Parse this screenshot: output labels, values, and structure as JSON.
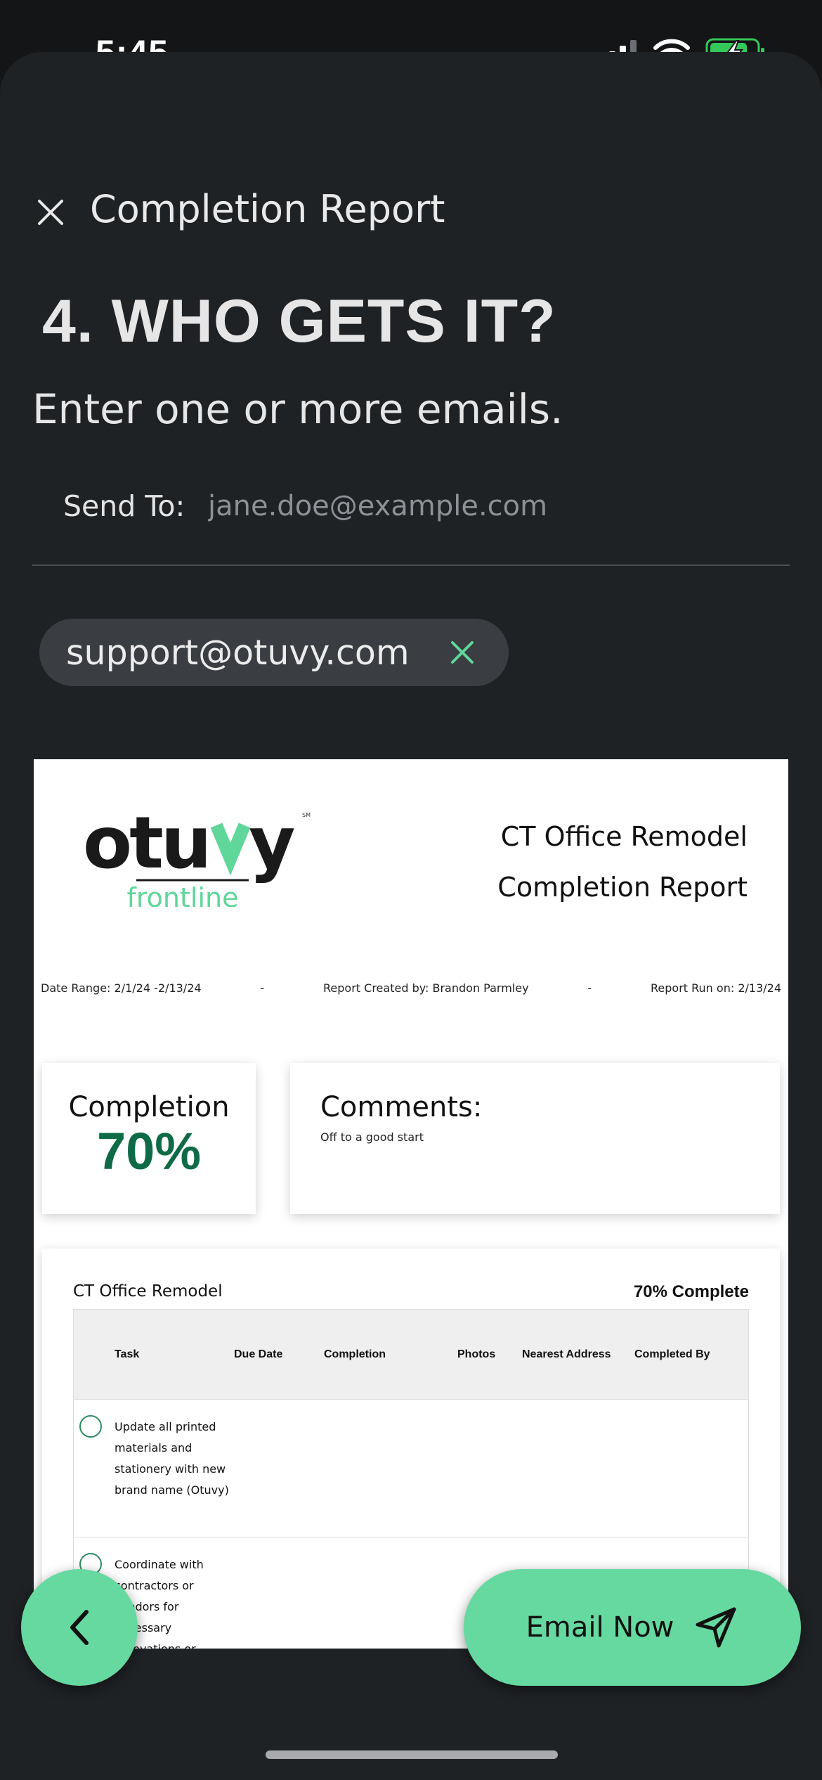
{
  "status_bar": {
    "time": "5:45",
    "icons": [
      "cellular-signal-icon",
      "wifi-icon",
      "battery-charging-icon"
    ]
  },
  "header": {
    "title": "Completion Report",
    "close_icon": "close-icon"
  },
  "step": {
    "heading": "4. WHO GETS IT?",
    "instruction": "Enter one or more emails."
  },
  "send_to": {
    "label": "Send To:",
    "placeholder": "jane.doe@example.com",
    "value": ""
  },
  "recipients": [
    {
      "email": "support@otuvy.com"
    }
  ],
  "report": {
    "logo_text": "otuvy",
    "logo_subtext": "frontline",
    "title_line1": "CT Office Remodel",
    "title_line2": "Completion Report",
    "meta": {
      "date_range": "Date Range: 2/1/24 -2/13/24",
      "sep1": "-",
      "created_by": "Report Created by: Brandon Parmley",
      "sep2": "-",
      "run_on": "Report Run on: 2/13/24"
    },
    "completion": {
      "label": "Completion",
      "value": "70%"
    },
    "comments": {
      "label": "Comments:",
      "text": "Off to a good start"
    },
    "tasks": {
      "project": "CT Office Remodel",
      "percent_label": "70% Complete",
      "columns": [
        "Task",
        "Due Date",
        "Completion",
        "Photos",
        "Nearest Address",
        "Completed By"
      ],
      "rows": [
        {
          "task": "Update all printed materials and stationery with new brand name (Otuvy)"
        },
        {
          "task": "Coordinate with contractors or vendors for necessary renovations or"
        }
      ]
    }
  },
  "actions": {
    "back_icon": "chevron-left-icon",
    "email_label": "Email Now",
    "email_icon": "send-icon"
  },
  "colors": {
    "accent": "#66d9a0",
    "completion_green": "#0e6b45",
    "background": "#1f2225"
  }
}
